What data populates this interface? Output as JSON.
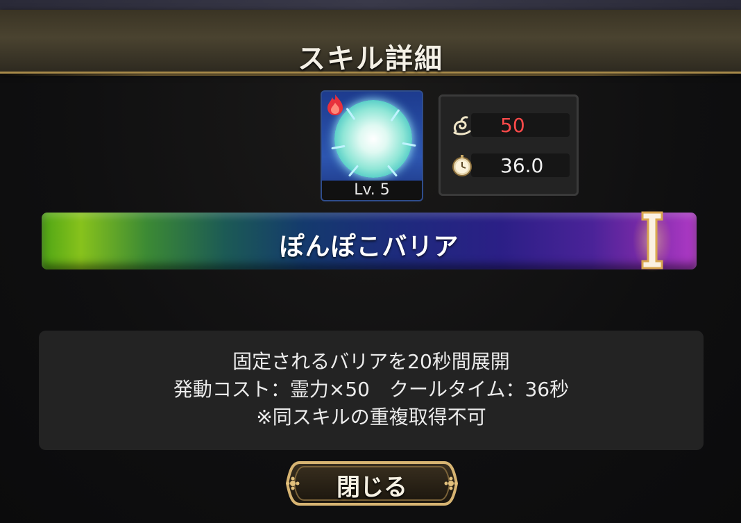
{
  "dialog": {
    "title": "スキル詳細"
  },
  "skill": {
    "icon": "barrier-orb-icon",
    "element_icon": "fire-icon",
    "level": "Lv. 5",
    "name": "ぽんぽこバリア",
    "rank_icon": "rank-one-icon"
  },
  "stats": {
    "cost_icon": "spirit-power-icon",
    "cost_value": "50",
    "cost_color": "#ff4a4a",
    "cooldown_icon": "stopwatch-icon",
    "cooldown_value": "36.0"
  },
  "description": {
    "lines": [
      "固定されるバリアを20秒間展開",
      "発動コスト：霊力×50　クールタイム：36秒",
      "※同スキルの重複取得不可"
    ]
  },
  "buttons": {
    "close_label": "閉じる"
  }
}
